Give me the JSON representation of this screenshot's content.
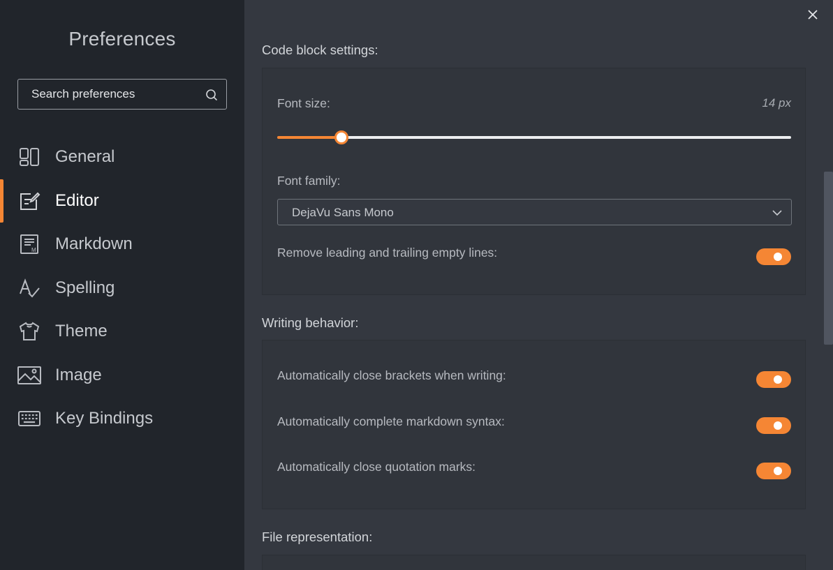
{
  "sidebar": {
    "title": "Preferences",
    "search": {
      "placeholder": "Search preferences",
      "value": ""
    },
    "items": [
      {
        "label": "General",
        "icon": "general-icon",
        "active": false
      },
      {
        "label": "Editor",
        "icon": "editor-icon",
        "active": true
      },
      {
        "label": "Markdown",
        "icon": "markdown-icon",
        "active": false
      },
      {
        "label": "Spelling",
        "icon": "spelling-icon",
        "active": false
      },
      {
        "label": "Theme",
        "icon": "theme-icon",
        "active": false
      },
      {
        "label": "Image",
        "icon": "image-icon",
        "active": false
      },
      {
        "label": "Key Bindings",
        "icon": "keyboard-icon",
        "active": false
      }
    ]
  },
  "colors": {
    "accent": "#f58634",
    "sidebar_bg": "#21252b",
    "main_bg": "#343840"
  },
  "main": {
    "code_block": {
      "title": "Code block settings:",
      "font_size_label": "Font size:",
      "font_size_value": "14 px",
      "font_size_fraction": 0.125,
      "font_family_label": "Font family:",
      "font_family_value": "DejaVu Sans Mono",
      "trim_lines_label": "Remove leading and trailing empty lines:",
      "trim_lines_on": true
    },
    "writing": {
      "title": "Writing behavior:",
      "options": [
        {
          "label": "Automatically close brackets when writing:",
          "on": true
        },
        {
          "label": "Automatically complete markdown syntax:",
          "on": true
        },
        {
          "label": "Automatically close quotation marks:",
          "on": true
        }
      ]
    },
    "file_representation": {
      "title": "File representation:"
    }
  }
}
